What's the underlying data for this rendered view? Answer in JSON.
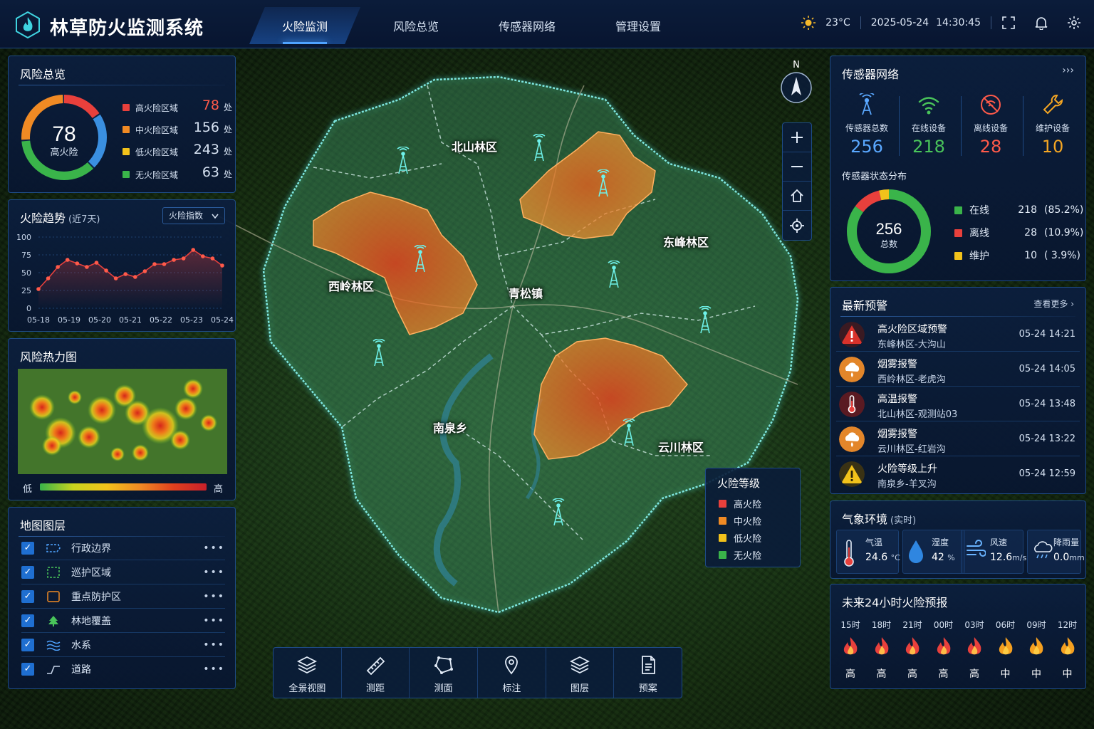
{
  "app": {
    "title": "林草防火监测系统"
  },
  "nav": {
    "items": [
      "火险监测",
      "风险总览",
      "传感器网络",
      "管理设置"
    ],
    "active": "火险监测"
  },
  "header": {
    "temperature": "23°C",
    "date": "2025-05-24",
    "time": "14:30:45"
  },
  "risk_overview": {
    "title": "风险总览",
    "center_value": "78",
    "center_label": "高火险",
    "items": [
      {
        "label": "高火险区域",
        "value": "78",
        "unit": "处",
        "color": "#e8403c"
      },
      {
        "label": "中火险区域",
        "value": "156",
        "unit": "处",
        "color": "#f08a24"
      },
      {
        "label": "低火险区域",
        "value": "243",
        "unit": "处",
        "color": "#f2c21b"
      },
      {
        "label": "无火险区域",
        "value": "63",
        "unit": "处",
        "color": "#3ab44a"
      }
    ]
  },
  "trend": {
    "title": "火险趋势",
    "subtitle": "(近7天)",
    "selector": "火险指数",
    "chart_data": {
      "type": "line",
      "x": [
        "05-18",
        "05-19",
        "05-20",
        "05-21",
        "05-22",
        "05-23",
        "05-24"
      ],
      "values": [
        27,
        42,
        58,
        68,
        63,
        58,
        64,
        53,
        42,
        48,
        44,
        52,
        62,
        62,
        68,
        70,
        82,
        73,
        70,
        60
      ],
      "y_ticks": [
        "0",
        "25",
        "50",
        "75",
        "100"
      ],
      "ylim": [
        0,
        100
      ],
      "grid": true
    }
  },
  "heatmap": {
    "title": "风险热力图",
    "low": "低",
    "high": "高"
  },
  "layers": {
    "title": "地图图层",
    "items": [
      {
        "label": "行政边界",
        "icon": "boundary-icon",
        "checked": true
      },
      {
        "label": "巡护区域",
        "icon": "patrol-area-icon",
        "checked": true
      },
      {
        "label": "重点防护区",
        "icon": "key-zone-icon",
        "checked": true
      },
      {
        "label": "林地覆盖",
        "icon": "tree-icon",
        "checked": true
      },
      {
        "label": "水系",
        "icon": "water-icon",
        "checked": true
      },
      {
        "label": "道路",
        "icon": "road-icon",
        "checked": true
      }
    ],
    "more": "•••"
  },
  "map": {
    "compass": "N",
    "places": [
      {
        "name": "北山林区"
      },
      {
        "name": "东峰林区"
      },
      {
        "name": "西岭林区"
      },
      {
        "name": "青松镇"
      },
      {
        "name": "南泉乡"
      },
      {
        "name": "云川林区"
      }
    ],
    "legend": {
      "title": "火险等级",
      "items": [
        {
          "label": "高火险",
          "color": "#e8403c"
        },
        {
          "label": "中火险",
          "color": "#f08a24"
        },
        {
          "label": "低火险",
          "color": "#f2c21b"
        },
        {
          "label": "无火险",
          "color": "#3ab44a"
        }
      ]
    }
  },
  "toolbar": {
    "items": [
      {
        "label": "全景视图",
        "icon": "layers-stack-icon"
      },
      {
        "label": "测距",
        "icon": "ruler-icon"
      },
      {
        "label": "测面",
        "icon": "polygon-icon"
      },
      {
        "label": "标注",
        "icon": "pin-icon"
      },
      {
        "label": "图层",
        "icon": "layers-icon"
      },
      {
        "label": "预案",
        "icon": "document-icon"
      }
    ]
  },
  "sensors": {
    "title": "传感器网络",
    "more": "›››",
    "stats": [
      {
        "label": "传感器总数",
        "value": "256",
        "color": "#5aa8ff",
        "icon": "antenna-icon"
      },
      {
        "label": "在线设备",
        "value": "218",
        "color": "#49c45a",
        "icon": "wifi-icon"
      },
      {
        "label": "离线设备",
        "value": "28",
        "color": "#ff5a4a",
        "icon": "offline-icon"
      },
      {
        "label": "维护设备",
        "value": "10",
        "color": "#f5a623",
        "icon": "wrench-icon"
      }
    ],
    "dist_title": "传感器状态分布",
    "donut_value": "256",
    "donut_label": "总数",
    "dist": [
      {
        "label": "在线",
        "count": "218",
        "pct": "(85.2%)",
        "color": "#3ab44a",
        "value": 218
      },
      {
        "label": "离线",
        "count": "28",
        "pct": "(10.9%)",
        "color": "#e8403c",
        "value": 28
      },
      {
        "label": "维护",
        "count": "10",
        "pct": "( 3.9%)",
        "color": "#f2c21b",
        "value": 10
      }
    ]
  },
  "alerts": {
    "title": "最新预警",
    "more": "查看更多",
    "items": [
      {
        "title": "高火险区域预警",
        "location": "东峰林区-大沟山",
        "time": "05-24 14:21",
        "icon": "warning-icon",
        "color": "#d9322b"
      },
      {
        "title": "烟雾报警",
        "location": "西岭林区-老虎沟",
        "time": "05-24 14:05",
        "icon": "smoke-icon",
        "color": "#e3862a"
      },
      {
        "title": "高温报警",
        "location": "北山林区-观测站03",
        "time": "05-24 13:48",
        "icon": "thermometer-icon",
        "color": "#c8323a"
      },
      {
        "title": "烟雾报警",
        "location": "云川林区-红岩沟",
        "time": "05-24 13:22",
        "icon": "smoke-icon",
        "color": "#e3862a"
      },
      {
        "title": "火险等级上升",
        "location": "南泉乡-羊叉沟",
        "time": "05-24 12:59",
        "icon": "warning-icon",
        "color": "#f2c21b"
      }
    ]
  },
  "weather": {
    "title": "气象环境",
    "subtitle": "(实时)",
    "items": [
      {
        "label": "气温",
        "value": "24.6",
        "unit": "°C",
        "icon": "thermometer-icon"
      },
      {
        "label": "湿度",
        "value": "42",
        "unit": "%",
        "icon": "droplet-icon"
      },
      {
        "label": "风速",
        "value": "12.6",
        "unit": "m/s",
        "icon": "wind-icon"
      },
      {
        "label": "降雨量",
        "value": "0.0",
        "unit": "mm",
        "icon": "rain-cloud-icon"
      }
    ]
  },
  "forecast": {
    "title": "未来24小时火险预报",
    "items": [
      {
        "hour": "15时",
        "level": "高",
        "color": "#e8403c"
      },
      {
        "hour": "18时",
        "level": "高",
        "color": "#e8403c"
      },
      {
        "hour": "21时",
        "level": "高",
        "color": "#e8403c"
      },
      {
        "hour": "00时",
        "level": "高",
        "color": "#e8403c"
      },
      {
        "hour": "03时",
        "level": "高",
        "color": "#e8403c"
      },
      {
        "hour": "06时",
        "level": "中",
        "color": "#f5a020"
      },
      {
        "hour": "09时",
        "level": "中",
        "color": "#f5a020"
      },
      {
        "hour": "12时",
        "level": "中",
        "color": "#f5a020"
      }
    ]
  }
}
